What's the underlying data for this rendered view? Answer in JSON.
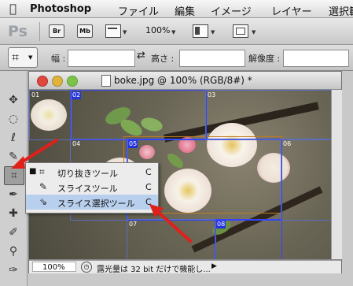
{
  "menubar": {
    "app_name": "Photoshop",
    "items": [
      "ファイル",
      "編集",
      "イメージ",
      "レイヤー",
      "選択範"
    ]
  },
  "appbar": {
    "logo": "Ps",
    "bridge_label": "Br",
    "minibridge_label": "Mb",
    "zoom_level": "100%"
  },
  "options": {
    "width_label": "幅 :",
    "height_label": "高さ :",
    "resolution_label": "解像度 :",
    "width_value": "",
    "height_value": "",
    "resolution_value": ""
  },
  "document": {
    "title": "boke.jpg @ 100% (RGB/8#) *",
    "status_zoom": "100%",
    "status_text": "露光量は 32 bit だけで機能し..."
  },
  "slices": [
    {
      "label": "01",
      "selected": false
    },
    {
      "label": "02",
      "selected": true
    },
    {
      "label": "03",
      "selected": false
    },
    {
      "label": "04",
      "selected": false
    },
    {
      "label": "05",
      "selected": true
    },
    {
      "label": "06",
      "selected": false
    },
    {
      "label": "07",
      "selected": false
    },
    {
      "label": "08",
      "selected": true
    }
  ],
  "flyout": {
    "items": [
      {
        "name": "切り抜きツール",
        "key": "C",
        "active": true,
        "icon": "crop-icon"
      },
      {
        "name": "スライスツール",
        "key": "C",
        "active": false,
        "icon": "slice-knife-icon"
      },
      {
        "name": "スライス選択ツール",
        "key": "C",
        "active": false,
        "icon": "slice-select-icon"
      }
    ]
  },
  "colors": {
    "arrow": "#e0201a",
    "slice_line": "#3344ff",
    "flyout_highlight": "#b8d0ee",
    "crop_rect": "#c07a20"
  }
}
